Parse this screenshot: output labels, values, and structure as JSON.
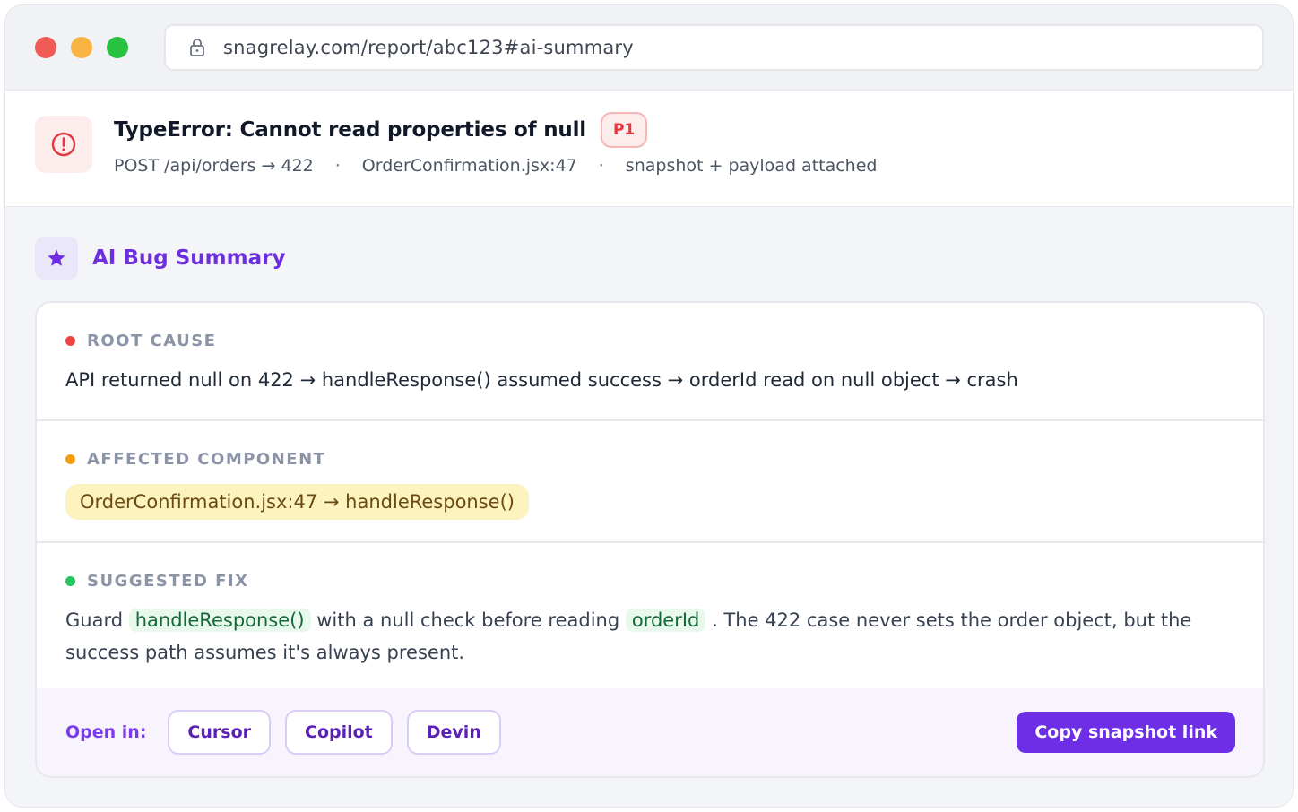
{
  "browser": {
    "url": "snagrelay.com/report/abc123#ai-summary"
  },
  "error": {
    "title": "TypeError: Cannot read properties of null",
    "priority": "P1",
    "request": "POST /api/orders → 422",
    "location": "OrderConfirmation.jsx:47",
    "attachments": "snapshot + payload attached",
    "separator": "·"
  },
  "ai_summary": {
    "title": "AI Bug Summary",
    "root_cause": {
      "label": "ROOT CAUSE",
      "text": "API returned null on 422 → handleResponse() assumed success → orderId read on null object → crash"
    },
    "affected_component": {
      "label": "AFFECTED COMPONENT",
      "value": "OrderConfirmation.jsx:47 → handleResponse()"
    },
    "suggested_fix": {
      "label": "SUGGESTED FIX",
      "part1": "Guard",
      "code1": "handleResponse()",
      "part2": "with a null check before reading",
      "code2": "orderId",
      "part3": ". The 422 case never sets the order object, but the success path assumes it's always present."
    }
  },
  "footer": {
    "open_in_label": "Open in:",
    "tools": [
      "Cursor",
      "Copilot",
      "Devin"
    ],
    "copy_label": "Copy snapshot link"
  },
  "colors": {
    "accent": "#6d2ee6",
    "root_cause_dot": "#ef4444",
    "component_dot": "#f59e0b",
    "fix_dot": "#22c55e",
    "error_red": "#e0383e"
  }
}
